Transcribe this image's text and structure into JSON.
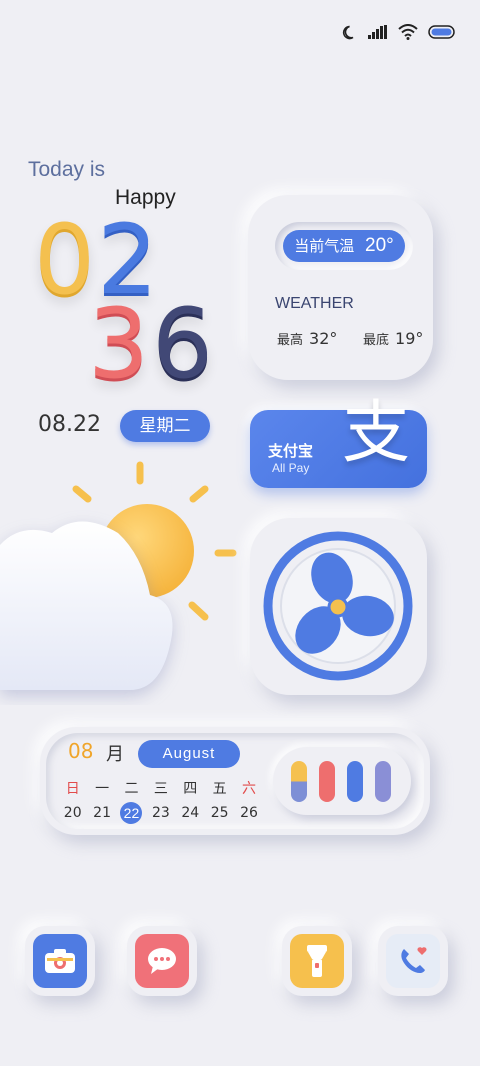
{
  "greeting": {
    "line1": "Today is",
    "line2": "Happy"
  },
  "clock": {
    "h1": "0",
    "h2": "2",
    "m1": "3",
    "m2": "6"
  },
  "date": {
    "value": "08.22",
    "weekday": "星期二"
  },
  "weather": {
    "current_label": "当前气温",
    "current_temp": "20°",
    "title": "WEATHER",
    "high_label": "最高",
    "high_value": "32°",
    "low_label": "最底",
    "low_value": "19°"
  },
  "alipay": {
    "title": "支付宝",
    "subtitle": "All Pay",
    "glyph": "支"
  },
  "calendar": {
    "month_number": "08",
    "month_char": "月",
    "month_name": "August",
    "weekdays": [
      "日",
      "一",
      "二",
      "三",
      "四",
      "五",
      "六"
    ],
    "days": [
      "20",
      "21",
      "22",
      "23",
      "24",
      "25",
      "26"
    ],
    "today": "22"
  },
  "colors": {
    "accent_blue": "#4f7be2",
    "yellow": "#f4c04f",
    "red": "#ee6e6e",
    "navy": "#414876",
    "background": "#efeff4"
  },
  "dock": {
    "icons": [
      "camera-icon",
      "message-icon",
      "flashlight-icon",
      "phone-icon"
    ]
  }
}
